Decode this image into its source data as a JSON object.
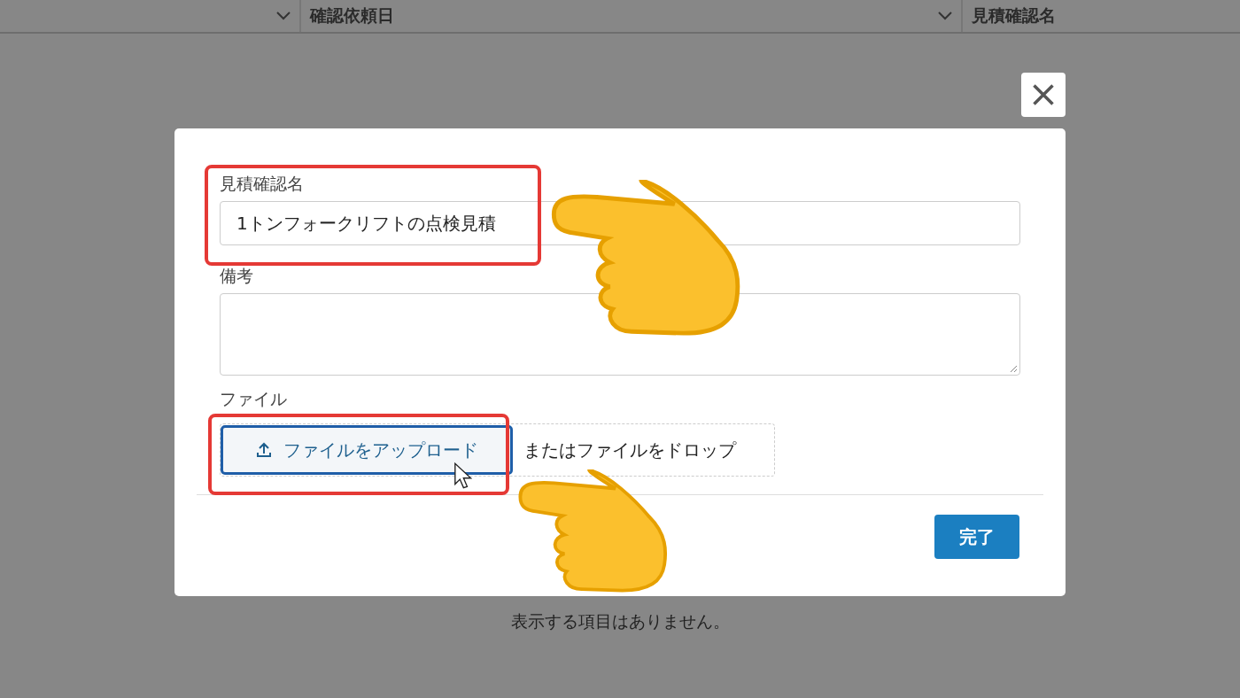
{
  "table_header": {
    "columns": [
      {
        "has_menu": true
      },
      {
        "label": "確認依頼日",
        "has_menu": true
      },
      {
        "label": "見積確認名",
        "has_menu": false
      }
    ]
  },
  "modal": {
    "fields": [
      {
        "kind": "input",
        "label": "見積確認名",
        "value": "1トンフォークリフトの点検見積"
      },
      {
        "kind": "textarea",
        "label": "備考"
      },
      {
        "kind": "file",
        "label": "ファイル",
        "button": "ファイルをアップロード",
        "focused": true,
        "drop_hint": "またはファイルをドロップ"
      }
    ],
    "done_button": "完了"
  },
  "empty_message": "表示する項目はありません。"
}
